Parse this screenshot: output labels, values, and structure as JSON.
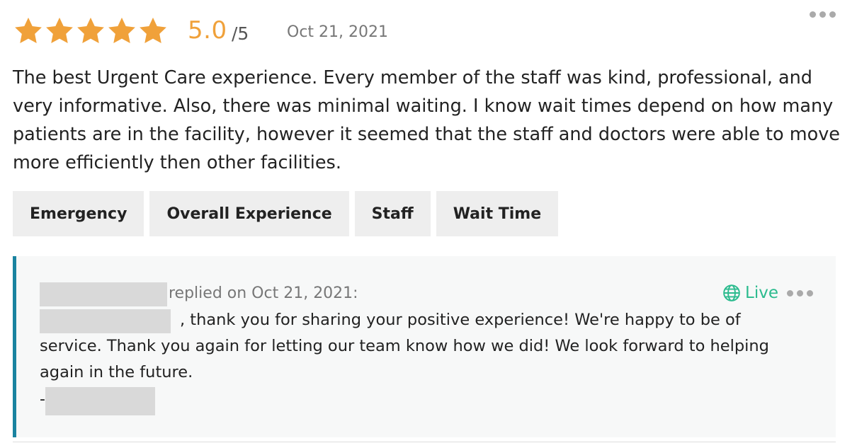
{
  "review": {
    "rating": 5,
    "rating_value": "5.0",
    "rating_max": "/5",
    "date": "Oct 21, 2021",
    "star_color": "#f0a13a",
    "text": "The best Urgent Care experience. Every member of the staff was kind, professional, and very informative. Also, there was minimal waiting. I know wait times depend on how many patients are in the facility, however it seemed that the staff and doctors were able to move more efficiently then other facilities."
  },
  "tags": [
    {
      "label": "Emergency"
    },
    {
      "label": "Overall Experience"
    },
    {
      "label": "Staff"
    },
    {
      "label": "Wait Time"
    }
  ],
  "reply": {
    "meta": "replied on Oct 21, 2021:",
    "status": "Live",
    "status_color": "#2bbb8e",
    "accent_color": "#1a83a0",
    "body": ", thank you for sharing your positive experience! We're happy to be of service. Thank you again for letting our team know how we did! We look forward to helping again in the future.",
    "signature_prefix": "-"
  },
  "icons": {
    "star": "star-icon",
    "more": "more-horizontal-icon",
    "globe": "globe-icon"
  }
}
